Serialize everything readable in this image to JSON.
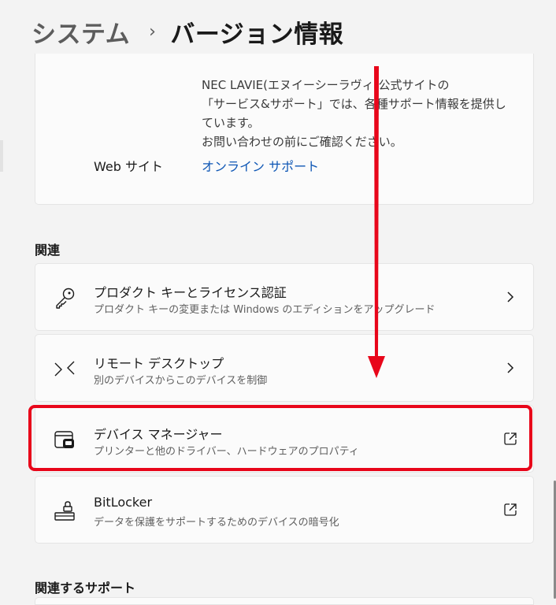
{
  "breadcrumb": {
    "parent": "システム",
    "separator": "›",
    "current": "バージョン情報"
  },
  "support_card": {
    "description": "NEC LAVIE(エヌイーシーラヴィ)公式サイトの\n「サービス&サポート」では、各種サポート情報を提供し\nています。\nお問い合わせの前にご確認ください。",
    "web_label": "Web サイト",
    "web_link": "オンライン サポート"
  },
  "related": {
    "header": "関連",
    "items": [
      {
        "title": "プロダクト キーとライセンス認証",
        "subtitle": "プロダクト キーの変更または Windows のエディションをアップグレード",
        "icon": "key-icon",
        "end_icon": "chevron-right-icon"
      },
      {
        "title": "リモート デスクトップ",
        "subtitle": "別のデバイスからこのデバイスを制御",
        "icon": "remote-desktop-icon",
        "end_icon": "chevron-right-icon"
      },
      {
        "title": "デバイス マネージャー",
        "subtitle": "プリンターと他のドライバー、ハードウェアのプロパティ",
        "icon": "device-manager-icon",
        "end_icon": "external-link-icon"
      },
      {
        "title": "BitLocker",
        "subtitle": "データを保護をサポートするためのデバイスの暗号化",
        "icon": "bitlocker-icon",
        "end_icon": "external-link-icon"
      }
    ]
  },
  "related_support": {
    "header": "関連するサポート"
  },
  "colors": {
    "accent_link": "#0f57b5",
    "highlight": "#e8061a",
    "background": "#f3f3f3",
    "card": "#fbfbfb"
  }
}
